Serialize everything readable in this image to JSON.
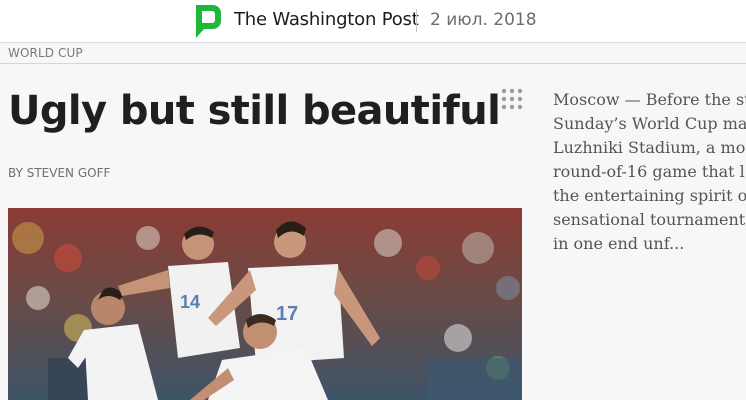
{
  "header": {
    "publisher": "The Washington Post",
    "date": "2 июл. 2018",
    "logo_icon": "green-speech-bubble-logo",
    "accent_color": "#1db83a"
  },
  "section": {
    "label": "WORLD CUP"
  },
  "article": {
    "headline": "Ugly but still beautiful",
    "byline": "BY STEVEN GOFF",
    "photo": {
      "icon": "players-celebrating-photo",
      "jersey_numbers": [
        "14",
        "17"
      ]
    },
    "excerpt_lines": [
      "Moscow — Before the st",
      "Sunday’s World Cup mat",
      "Luzhniki Stadium, a mor",
      "round-of-16 game that l",
      "the entertaining spirit of",
      "sensational tournament,",
      "in one end unf..."
    ]
  },
  "actions": {
    "more_icon": "grid-dots-icon"
  }
}
